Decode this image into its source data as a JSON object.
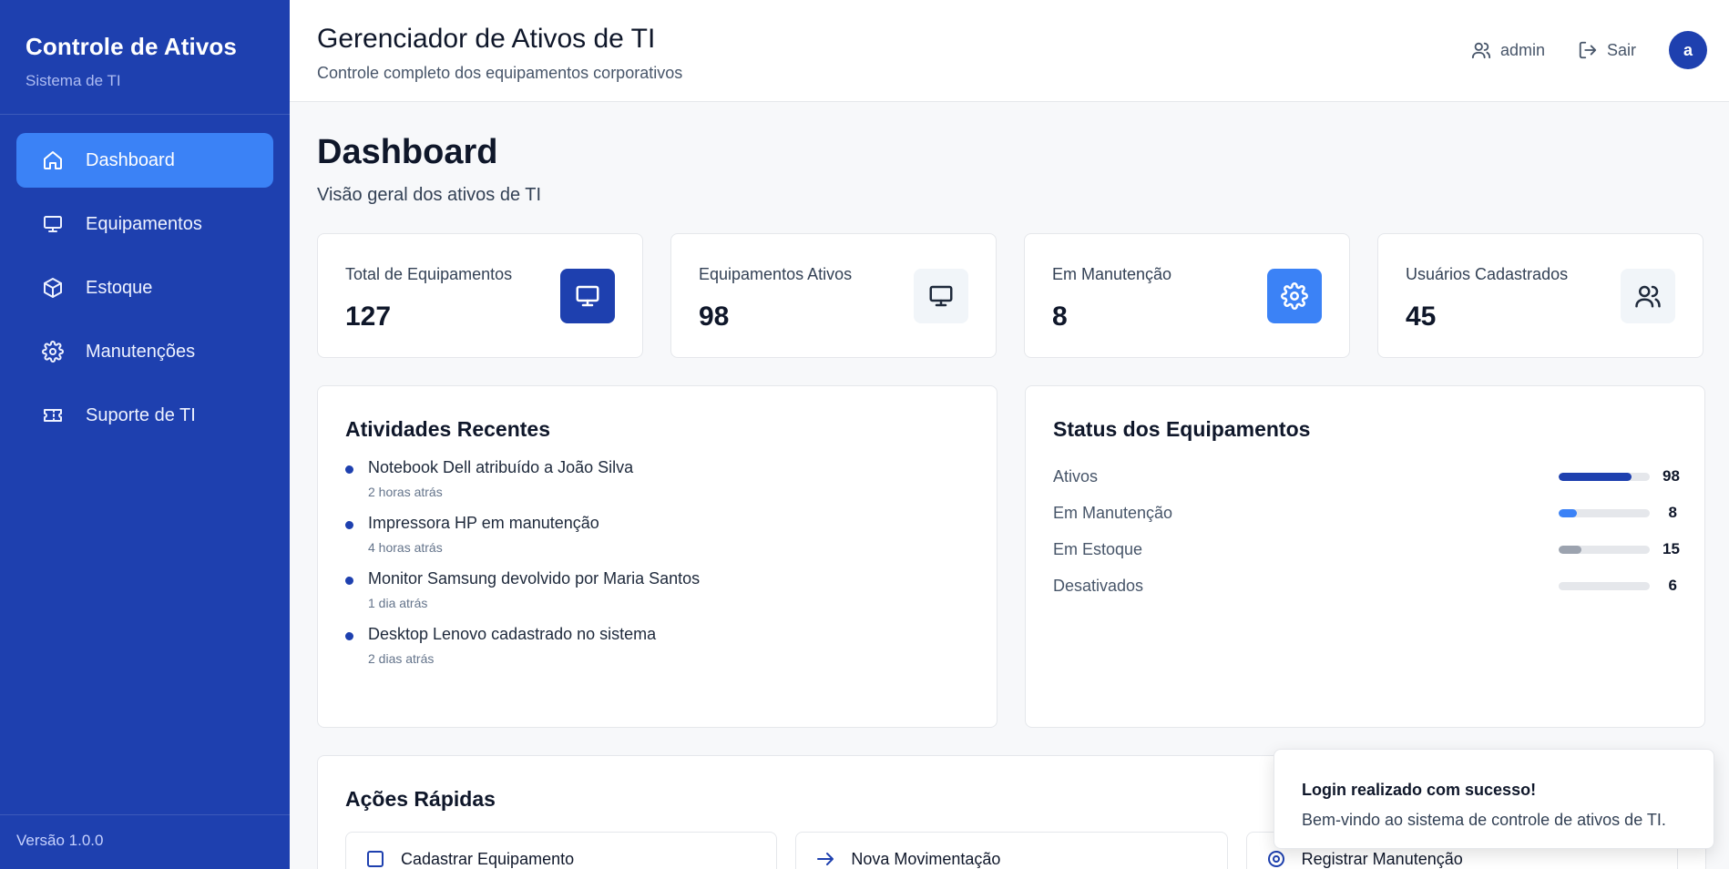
{
  "sidebar": {
    "brand_title": "Controle de Ativos",
    "brand_subtitle": "Sistema de TI",
    "items": [
      {
        "label": "Dashboard",
        "icon": "home-icon",
        "active": true
      },
      {
        "label": "Equipamentos",
        "icon": "monitor-icon",
        "active": false
      },
      {
        "label": "Estoque",
        "icon": "box-icon",
        "active": false
      },
      {
        "label": "Manutenções",
        "icon": "gear-icon",
        "active": false
      },
      {
        "label": "Suporte de TI",
        "icon": "ticket-icon",
        "active": false
      }
    ],
    "version": "Versão 1.0.0"
  },
  "header": {
    "title": "Gerenciador de Ativos de TI",
    "subtitle": "Controle completo dos equipamentos corporativos",
    "user_label": "admin",
    "logout_label": "Sair",
    "avatar_letter": "a"
  },
  "main": {
    "title": "Dashboard",
    "subtitle": "Visão geral dos ativos de TI",
    "stats": [
      {
        "label": "Total de Equipamentos",
        "value": "127",
        "icon": "monitor-icon",
        "icon_bg": "#1e40af",
        "icon_color": "#ffffff"
      },
      {
        "label": "Equipamentos Ativos",
        "value": "98",
        "icon": "monitor-icon",
        "icon_bg": "#f1f5f9",
        "icon_color": "#1e293b"
      },
      {
        "label": "Em Manutenção",
        "value": "8",
        "icon": "gear-icon",
        "icon_bg": "#3b82f6",
        "icon_color": "#ffffff"
      },
      {
        "label": "Usuários Cadastrados",
        "value": "45",
        "icon": "users-icon",
        "icon_bg": "#f1f5f9",
        "icon_color": "#1e293b"
      }
    ],
    "activities_title": "Atividades Recentes",
    "activities": [
      {
        "text": "Notebook Dell atribuído a João Silva",
        "time": "2 horas atrás"
      },
      {
        "text": "Impressora HP em manutenção",
        "time": "4 horas atrás"
      },
      {
        "text": "Monitor Samsung devolvido por Maria Santos",
        "time": "1 dia atrás"
      },
      {
        "text": "Desktop Lenovo cadastrado no sistema",
        "time": "2 dias atrás"
      }
    ],
    "status_title": "Status dos Equipamentos",
    "status": [
      {
        "label": "Ativos",
        "value": "98",
        "fill": 0.8,
        "color": "#1e40af"
      },
      {
        "label": "Em Manutenção",
        "value": "8",
        "fill": 0.2,
        "color": "#3b82f6"
      },
      {
        "label": "Em Estoque",
        "value": "15",
        "fill": 0.25,
        "color": "#9ca3af"
      },
      {
        "label": "Desativados",
        "value": "6",
        "fill": 0.08,
        "color": "#e5e7eb"
      }
    ],
    "quick_actions_title": "Ações Rápidas",
    "quick_actions": [
      {
        "label": "Cadastrar Equipamento",
        "icon": "square-icon"
      },
      {
        "label": "Nova Movimentação",
        "icon": "arrow-right-icon"
      },
      {
        "label": "Registrar Manutenção",
        "icon": "gear-icon"
      }
    ]
  },
  "toast": {
    "title": "Login realizado com sucesso!",
    "message": "Bem-vindo ao sistema de controle de ativos de TI."
  }
}
